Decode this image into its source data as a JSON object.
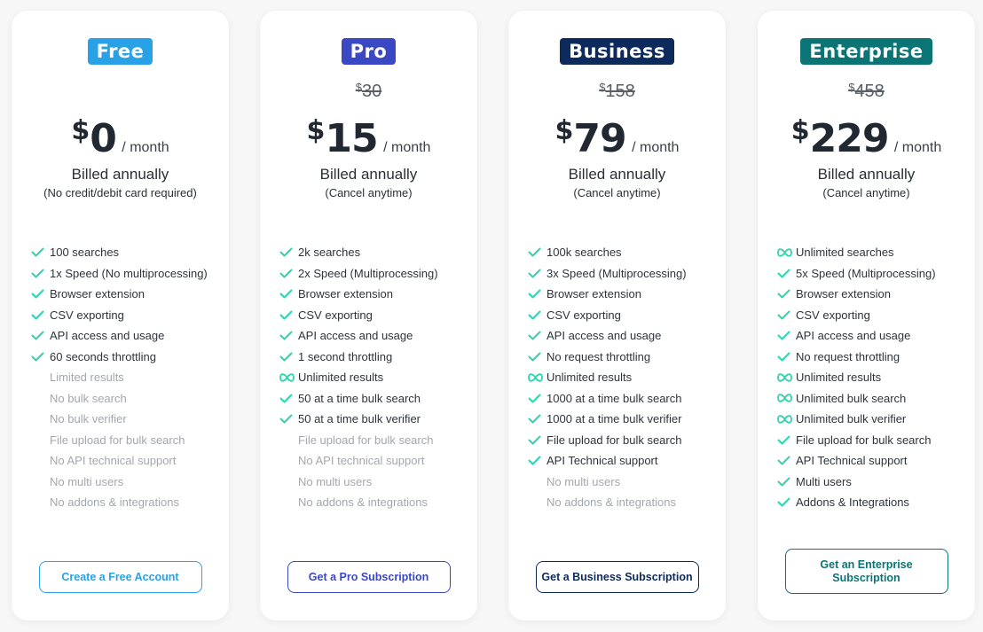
{
  "colors": {
    "check": "#2dd4b0",
    "text": "#2f343b",
    "muted": "#a3a7ad"
  },
  "plans": [
    {
      "name": "Free",
      "color": "#28a1e6",
      "old_price": "",
      "old_price_currency": "",
      "currency": "$",
      "price": "0",
      "period": "/ month",
      "billing": "Billed annually",
      "billing_note": "(No credit/debit card required)",
      "features": [
        {
          "icon": "check-icon",
          "text": "100 searches",
          "included": true
        },
        {
          "icon": "check-icon",
          "text": "1x Speed (No multiprocessing)",
          "included": true
        },
        {
          "icon": "check-icon",
          "text": "Browser extension",
          "included": true
        },
        {
          "icon": "check-icon",
          "text": "CSV exporting",
          "included": true
        },
        {
          "icon": "check-icon",
          "text": "API access and usage",
          "included": true
        },
        {
          "icon": "check-icon",
          "text": "60 seconds throttling",
          "included": true
        },
        {
          "icon": "none",
          "text": "Limited results",
          "included": false
        },
        {
          "icon": "none",
          "text": "No bulk search",
          "included": false
        },
        {
          "icon": "none",
          "text": "No bulk verifier",
          "included": false
        },
        {
          "icon": "none",
          "text": "File upload for bulk search",
          "included": false
        },
        {
          "icon": "none",
          "text": "No API technical support",
          "included": false
        },
        {
          "icon": "none",
          "text": "No multi users",
          "included": false
        },
        {
          "icon": "none",
          "text": "No addons & integrations",
          "included": false
        }
      ],
      "cta": "Create a Free Account"
    },
    {
      "name": "Pro",
      "color": "#3b48c4",
      "old_price": "30",
      "old_price_currency": "$",
      "currency": "$",
      "price": "15",
      "period": "/ month",
      "billing": "Billed annually",
      "billing_note": "(Cancel anytime)",
      "features": [
        {
          "icon": "check-icon",
          "text": "2k searches",
          "included": true
        },
        {
          "icon": "check-icon",
          "text": "2x Speed (Multiprocessing)",
          "included": true
        },
        {
          "icon": "check-icon",
          "text": "Browser extension",
          "included": true
        },
        {
          "icon": "check-icon",
          "text": "CSV exporting",
          "included": true
        },
        {
          "icon": "check-icon",
          "text": "API access and usage",
          "included": true
        },
        {
          "icon": "check-icon",
          "text": "1 second throttling",
          "included": true
        },
        {
          "icon": "infinity-icon",
          "text": "Unlimited results",
          "included": true
        },
        {
          "icon": "check-icon",
          "text": "50 at a time bulk search",
          "included": true
        },
        {
          "icon": "check-icon",
          "text": "50 at a time bulk verifier",
          "included": true
        },
        {
          "icon": "none",
          "text": "File upload for bulk search",
          "included": false
        },
        {
          "icon": "none",
          "text": "No API technical support",
          "included": false
        },
        {
          "icon": "none",
          "text": "No multi users",
          "included": false
        },
        {
          "icon": "none",
          "text": "No addons & integrations",
          "included": false
        }
      ],
      "cta": "Get a Pro Subscription"
    },
    {
      "name": "Business",
      "color": "#0d2a5c",
      "old_price": "158",
      "old_price_currency": "$",
      "currency": "$",
      "price": "79",
      "period": "/ month",
      "billing": "Billed annually",
      "billing_note": "(Cancel anytime)",
      "features": [
        {
          "icon": "check-icon",
          "text": "100k searches",
          "included": true
        },
        {
          "icon": "check-icon",
          "text": "3x Speed (Multiprocessing)",
          "included": true
        },
        {
          "icon": "check-icon",
          "text": "Browser extension",
          "included": true
        },
        {
          "icon": "check-icon",
          "text": "CSV exporting",
          "included": true
        },
        {
          "icon": "check-icon",
          "text": "API access and usage",
          "included": true
        },
        {
          "icon": "check-icon",
          "text": "No request throttling",
          "included": true
        },
        {
          "icon": "infinity-icon",
          "text": "Unlimited results",
          "included": true
        },
        {
          "icon": "check-icon",
          "text": "1000 at a time bulk search",
          "included": true
        },
        {
          "icon": "check-icon",
          "text": "1000 at a time bulk verifier",
          "included": true
        },
        {
          "icon": "check-icon",
          "text": "File upload for bulk search",
          "included": true
        },
        {
          "icon": "check-icon",
          "text": "API Technical support",
          "included": true
        },
        {
          "icon": "none",
          "text": "No multi users",
          "included": false
        },
        {
          "icon": "none",
          "text": "No addons & integrations",
          "included": false
        }
      ],
      "cta": "Get a Business Subscription"
    },
    {
      "name": "Enterprise",
      "color": "#0b7475",
      "old_price": "458",
      "old_price_currency": "$",
      "currency": "$",
      "price": "229",
      "period": "/ month",
      "billing": "Billed annually",
      "billing_note": "(Cancel anytime)",
      "features": [
        {
          "icon": "infinity-icon",
          "text": "Unlimited searches",
          "included": true
        },
        {
          "icon": "check-icon",
          "text": "5x Speed (Multiprocessing)",
          "included": true
        },
        {
          "icon": "check-icon",
          "text": "Browser extension",
          "included": true
        },
        {
          "icon": "check-icon",
          "text": "CSV exporting",
          "included": true
        },
        {
          "icon": "check-icon",
          "text": "API access and usage",
          "included": true
        },
        {
          "icon": "check-icon",
          "text": "No request throttling",
          "included": true
        },
        {
          "icon": "infinity-icon",
          "text": "Unlimited results",
          "included": true
        },
        {
          "icon": "infinity-icon",
          "text": "Unlimited bulk search",
          "included": true
        },
        {
          "icon": "infinity-icon",
          "text": "Unlimited bulk verifier",
          "included": true
        },
        {
          "icon": "check-icon",
          "text": "File upload for bulk search",
          "included": true
        },
        {
          "icon": "check-icon",
          "text": "API Technical support",
          "included": true
        },
        {
          "icon": "check-icon",
          "text": "Multi users",
          "included": true
        },
        {
          "icon": "check-icon",
          "text": "Addons & Integrations",
          "included": true
        }
      ],
      "cta": "Get an Enterprise Subscription"
    }
  ]
}
